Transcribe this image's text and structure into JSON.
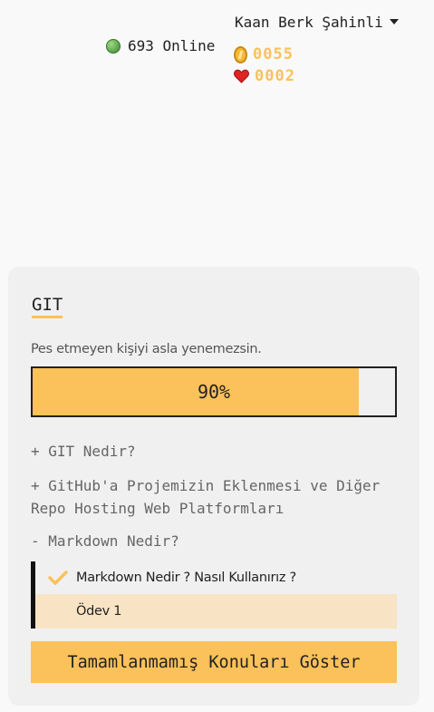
{
  "header": {
    "online_text": "693 Online",
    "user_name": "Kaan Berk Şahinli",
    "coins": "0055",
    "hearts": "0002"
  },
  "course": {
    "title": "GIT",
    "motto": "Pes etmeyen kişiyi asla yenemezsin.",
    "progress_value": 0.9,
    "progress_text": "90%",
    "topics": [
      {
        "label": "+ GIT Nedir?"
      },
      {
        "label": "+ GitHub'a Projemizin Eklenmesi ve Diğer Repo Hosting Web Platformları"
      },
      {
        "label": "- Markdown Nedir?"
      }
    ],
    "subitems": [
      {
        "label": "Markdown Nedir ? Nasıl Kullanırız ?",
        "completed": true
      },
      {
        "label": "Ödev 1",
        "completed": false
      }
    ],
    "show_button": "Tamamlanmamış Konuları Göster"
  },
  "colors": {
    "accent": "#fbc15a",
    "subitem_highlight": "#f8e4c4",
    "card_bg": "#f0f0f0",
    "heart": "#e02424",
    "online_dot": "#4f9a3d"
  },
  "icons": {
    "online": "green-dot-icon",
    "coin": "coin-icon",
    "heart": "heart-icon",
    "dropdown": "caret-down-icon",
    "completed": "check-icon"
  }
}
